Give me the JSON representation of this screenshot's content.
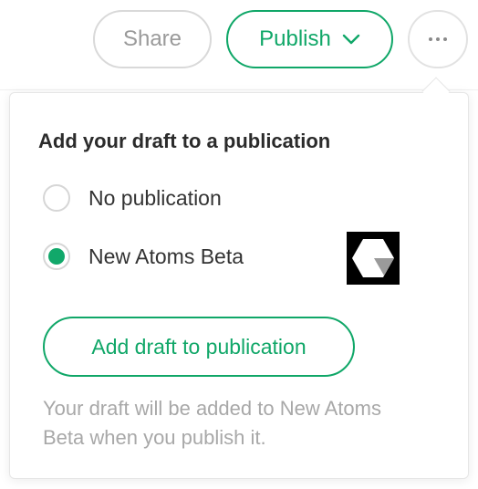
{
  "toolbar": {
    "share_label": "Share",
    "publish_label": "Publish",
    "more_icon": "more-horizontal-icon"
  },
  "popover": {
    "title": "Add your draft to a publication",
    "options": [
      {
        "label": "No publication",
        "selected": false
      },
      {
        "label": "New Atoms Beta",
        "selected": true
      }
    ],
    "publication_logo": "hexagon-logo-icon",
    "add_button_label": "Add draft to publication",
    "note": "Your draft will be added to New Atoms Beta when you publish it."
  },
  "colors": {
    "accent": "#10a768",
    "muted_text": "#a8a8a8",
    "border": "#d9d9d9"
  }
}
